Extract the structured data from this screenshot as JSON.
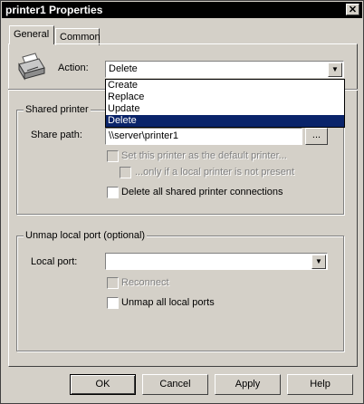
{
  "window": {
    "title": "printer1 Properties",
    "close_symbol": "✕"
  },
  "tabs": [
    {
      "label": "General",
      "active": true
    },
    {
      "label": "Common",
      "active": false
    }
  ],
  "action": {
    "label": "Action:",
    "value": "Delete",
    "options": [
      "Create",
      "Replace",
      "Update",
      "Delete"
    ],
    "selected_option": "Delete"
  },
  "shared_printer": {
    "group_title": "Shared printer",
    "share_path_label": "Share path:",
    "share_path_value": "\\\\server\\printer1",
    "browse_label": "...",
    "set_default_label": "Set this printer as the default printer...",
    "only_if_local_label": "...only if a local printer is not present",
    "delete_all_label": "Delete all shared printer connections"
  },
  "unmap": {
    "group_title": "Unmap local port (optional)",
    "local_port_label": "Local port:",
    "local_port_value": "",
    "reconnect_label": "Reconnect",
    "unmap_all_label": "Unmap all local ports"
  },
  "buttons": {
    "ok": "OK",
    "cancel": "Cancel",
    "apply": "Apply",
    "help": "Help"
  },
  "colors": {
    "face": "#d4d0c8",
    "titlebar": "#000000",
    "selection": "#0a246a"
  },
  "icons": {
    "printer": "printer-icon",
    "dropdown": "chevron-down-icon"
  }
}
